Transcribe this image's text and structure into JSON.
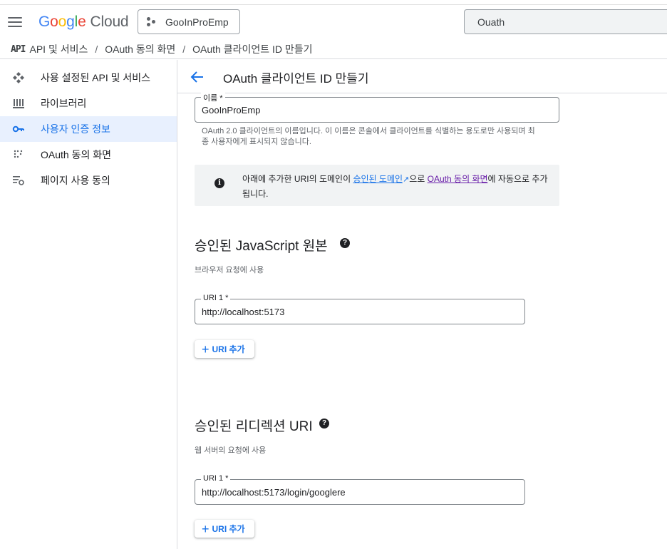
{
  "topbar": {
    "brand_google": [
      "G",
      "o",
      "o",
      "g",
      "l",
      "e"
    ],
    "brand_cloud": "Cloud",
    "project_name": "GooInProEmp",
    "search_value": "Ouath"
  },
  "breadcrumb": {
    "api_mark": "API",
    "items": [
      "API 및 서비스",
      "OAuth 동의 화면",
      "OAuth 클라이언트 ID 만들기"
    ],
    "separator": "/"
  },
  "sidebar": {
    "items": [
      {
        "label": "사용 설정된 API 및 서비스",
        "icon": "api-diamond-icon",
        "active": false
      },
      {
        "label": "라이브러리",
        "icon": "library-icon",
        "active": false
      },
      {
        "label": "사용자 인증 정보",
        "icon": "key-icon",
        "active": true
      },
      {
        "label": "OAuth 동의 화면",
        "icon": "oauth-dots-icon",
        "active": false
      },
      {
        "label": "페이지 사용 동의",
        "icon": "settings-list-icon",
        "active": false
      }
    ]
  },
  "header": {
    "title": "OAuth 클라이언트 ID 만들기"
  },
  "form": {
    "name_field": {
      "label": "이름 *",
      "value": "GooInProEmp",
      "hint_line1": "OAuth 2.0 클라이언트의 이름입니다. 이 이름은 콘솔에서 클라이언트를 식별하는 용도로만 사용되며 최",
      "hint_line2": "종 사용자에게 표시되지 않습니다."
    },
    "notice": {
      "text_before": "아래에 추가한 URI의 도메인이 ",
      "link1": "승인된 도메인",
      "text_mid": "으로 ",
      "link2": "OAuth 동의 화면",
      "text_after": "에 자동으로 추가됩니다."
    },
    "js_origins": {
      "title": "승인된 JavaScript 원본",
      "subtitle": "브라우저 요청에 사용",
      "uri_label": "URI 1 *",
      "uri_value": "http://localhost:5173",
      "add_label": "URI 추가"
    },
    "redirect_uris": {
      "title": "승인된 리디렉션 URI",
      "subtitle": "웹 서버의 요청에 사용",
      "uri_label": "URI 1 *",
      "uri_value": "http://localhost:5173/login/googlere",
      "add_label": "URI 추가"
    }
  },
  "colors": {
    "accent": "#1a73e8",
    "visited_link": "#681da8",
    "active_nav_bg": "#e8f0fe"
  }
}
